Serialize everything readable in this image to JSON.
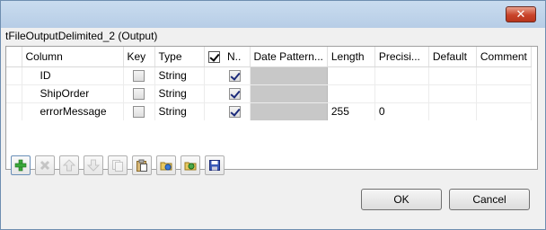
{
  "window": {
    "close_label": "✕"
  },
  "dialog": {
    "title": "tFileOutputDelimited_2 (Output)"
  },
  "table": {
    "columns": [
      "Column",
      "Key",
      "Type",
      "N..",
      "Date Pattern...",
      "Length",
      "Precisi...",
      "Default",
      "Comment"
    ],
    "rows": [
      {
        "column": "ID",
        "key": false,
        "type": "String",
        "nullable": true,
        "date_pattern": "",
        "length": "",
        "precision": "",
        "default": "",
        "comment": ""
      },
      {
        "column": "ShipOrder",
        "key": false,
        "type": "String",
        "nullable": true,
        "date_pattern": "",
        "length": "",
        "precision": "",
        "default": "",
        "comment": ""
      },
      {
        "column": "errorMessage",
        "key": false,
        "type": "String",
        "nullable": true,
        "date_pattern": "",
        "length": "255",
        "precision": "0",
        "default": "",
        "comment": ""
      }
    ]
  },
  "toolbar": {
    "icons": [
      "add-icon",
      "remove-icon",
      "move-up-icon",
      "move-down-icon",
      "copy-icon",
      "paste-icon",
      "import-icon",
      "export-icon",
      "save-icon"
    ]
  },
  "buttons": {
    "ok": "OK",
    "cancel": "Cancel"
  },
  "colors": {
    "titlebar": "#c0d6ee",
    "close": "#c9432a",
    "disabled_cell": "#c8c8c8",
    "add_icon": "#3aa83a"
  }
}
